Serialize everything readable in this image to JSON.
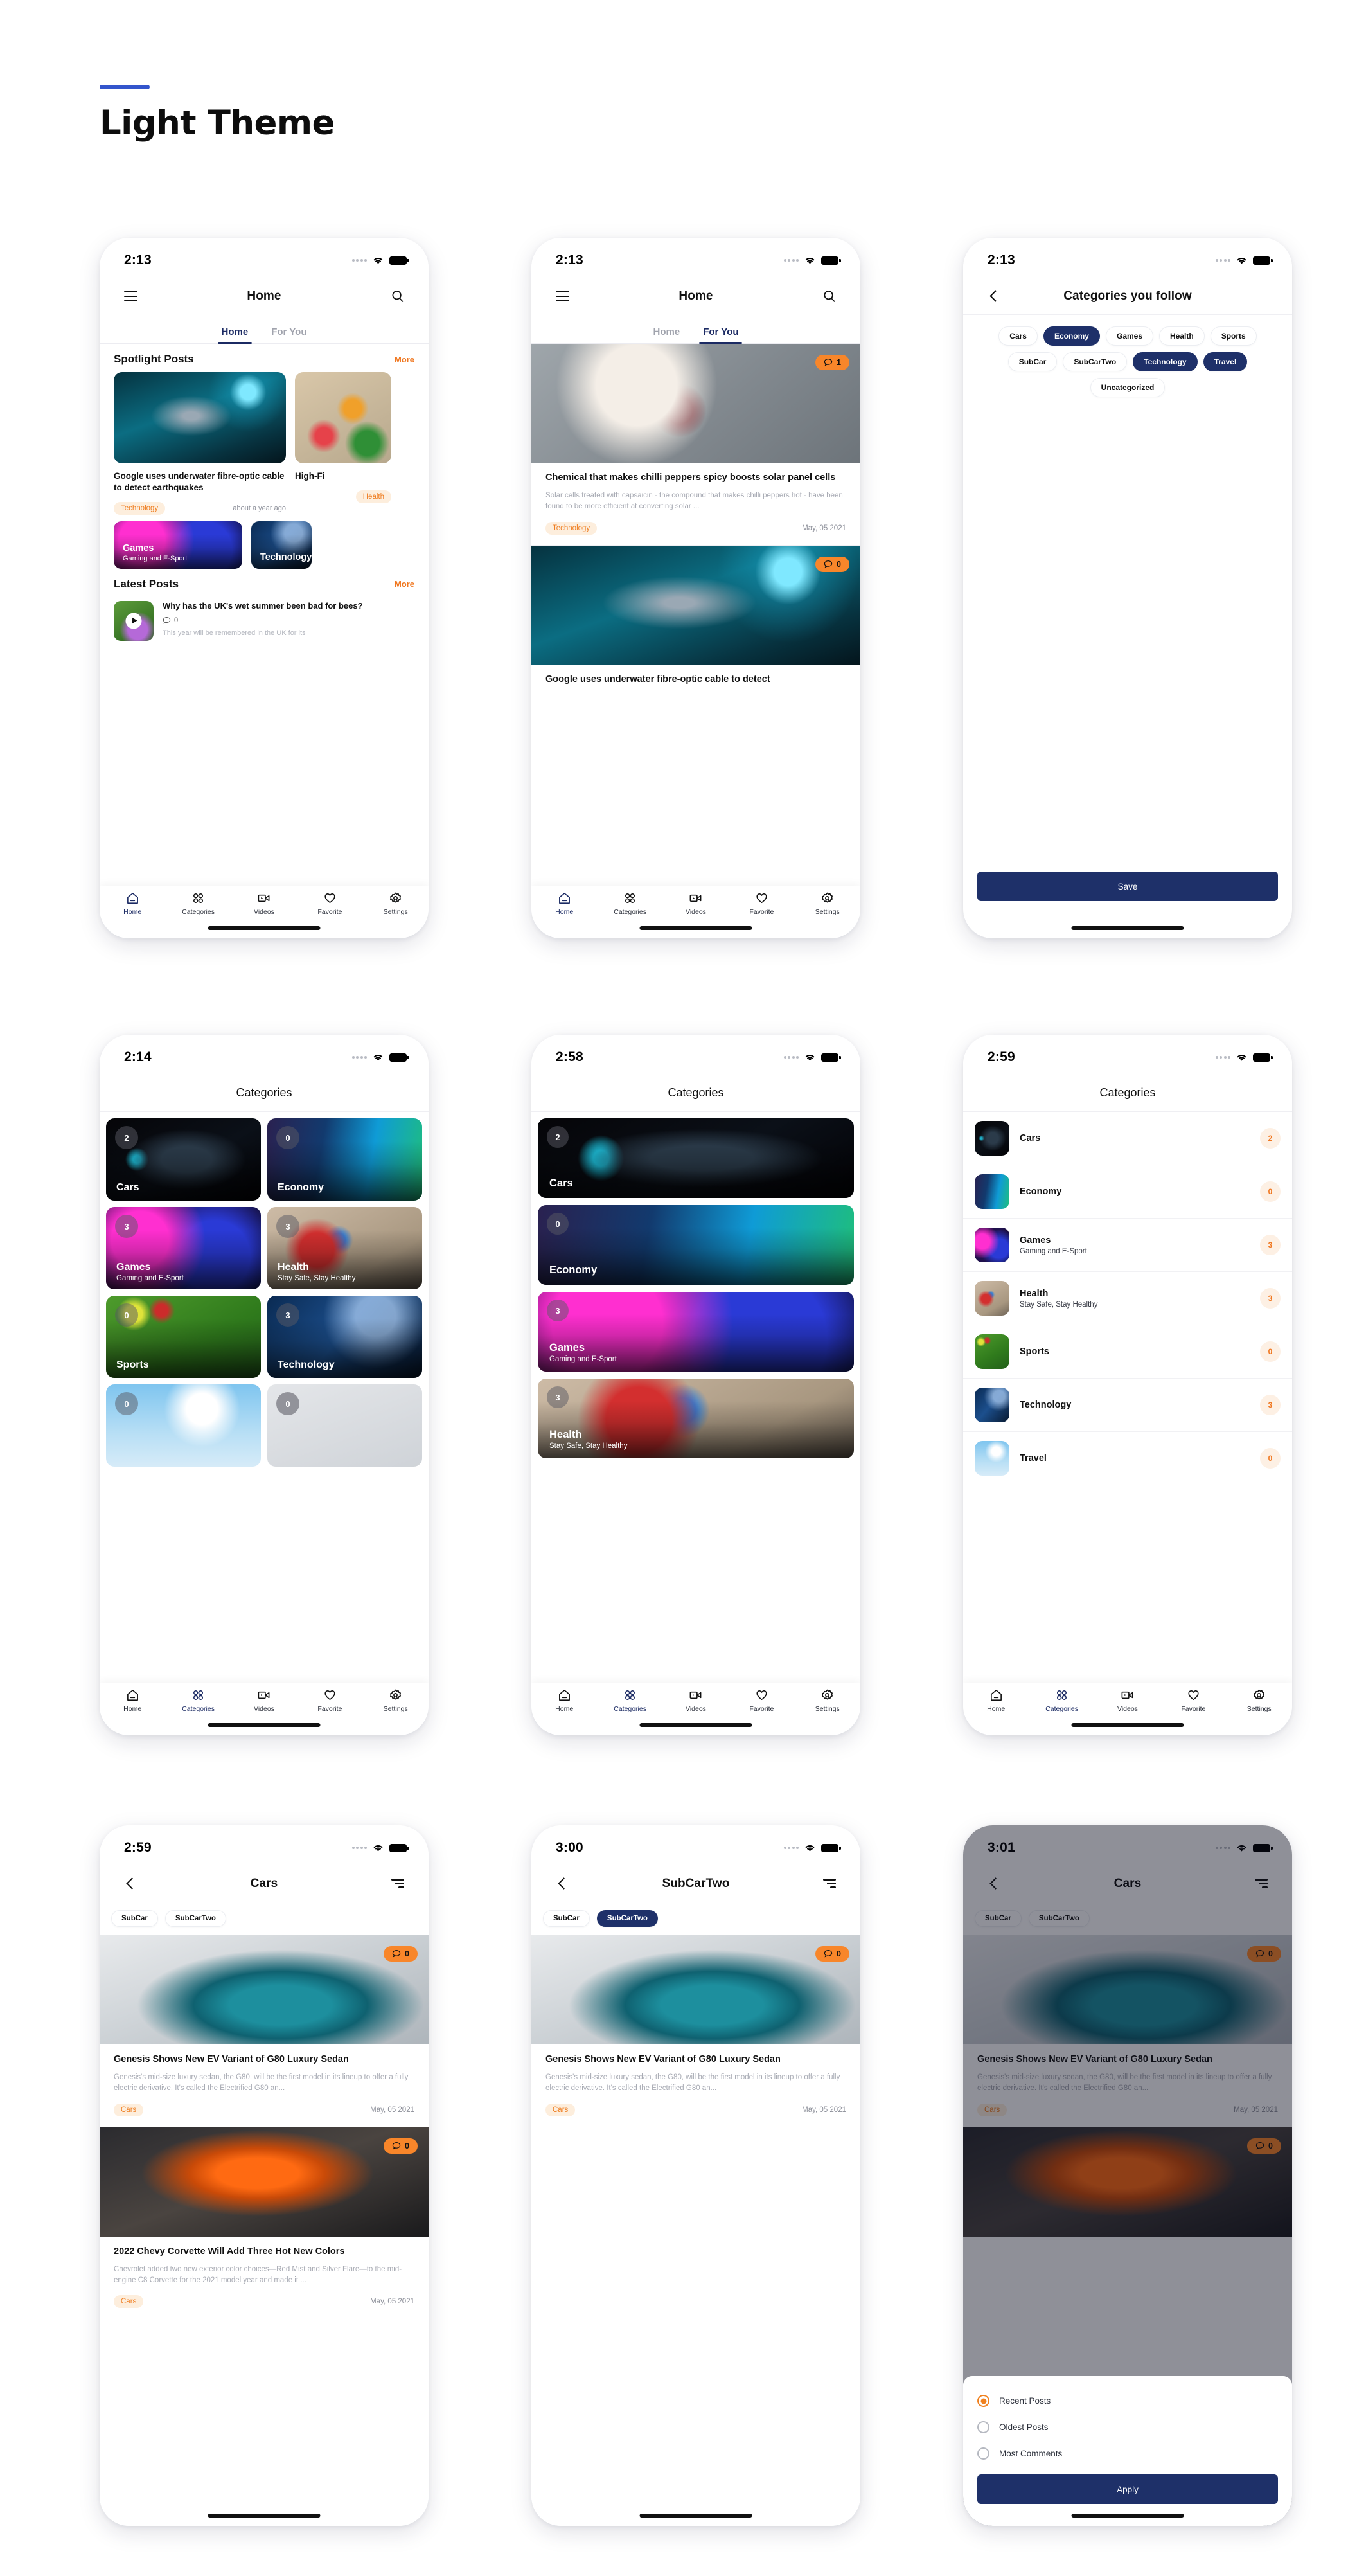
{
  "page": {
    "title": "Light Theme"
  },
  "status": {
    "time_213": "2:13",
    "time_214": "2:14",
    "time_258": "2:58",
    "time_259": "2:59",
    "time_300": "3:00",
    "time_301": "3:01"
  },
  "nav": {
    "items": [
      {
        "label": "Home",
        "icon": "home-icon"
      },
      {
        "label": "Categories",
        "icon": "grid-icon"
      },
      {
        "label": "Videos",
        "icon": "video-icon"
      },
      {
        "label": "Favorite",
        "icon": "heart-icon"
      },
      {
        "label": "Settings",
        "icon": "gear-icon"
      }
    ]
  },
  "screen_home": {
    "appbar_title": "Home",
    "menu_icon": "hamburger-icon",
    "search_icon": "search-icon",
    "tabs": [
      {
        "label": "Home",
        "active": true
      },
      {
        "label": "For You",
        "active": false
      }
    ],
    "spotlight": {
      "heading": "Spotlight Posts",
      "more": "More",
      "posts": [
        {
          "title": "Google uses underwater fibre-optic cable to detect earthquakes",
          "category": "Technology",
          "date": "about a year ago"
        },
        {
          "title": "High-Fi",
          "category": "Health"
        }
      ]
    },
    "category_tiles": [
      {
        "name": "Games",
        "sub": "Gaming and E-Sport"
      },
      {
        "name": "Technology",
        "sub": ""
      }
    ],
    "latest": {
      "heading": "Latest Posts",
      "more": "More",
      "post": {
        "title": "Why has the UK's wet summer been bad for bees?",
        "comments": "0",
        "excerpt": "This year will be remembered in the UK for its"
      }
    }
  },
  "screen_foryou": {
    "appbar_title": "Home",
    "tabs": [
      {
        "label": "Home",
        "active": false
      },
      {
        "label": "For You",
        "active": true
      }
    ],
    "posts": [
      {
        "comments": "1",
        "title": "Chemical that makes chilli peppers spicy boosts solar panel cells",
        "excerpt": "Solar cells treated with capsaicin - the compound that makes chilli peppers hot - have been found to be more efficient at converting solar ...",
        "category": "Technology",
        "date": "May, 05 2021"
      },
      {
        "comments": "0",
        "title": "Google uses underwater fibre-optic cable to detect",
        "excerpt": "",
        "category": "",
        "date": ""
      }
    ]
  },
  "screen_follow": {
    "appbar_title": "Categories you follow",
    "back_icon": "chevron-left-icon",
    "chips": [
      {
        "label": "Cars",
        "selected": false
      },
      {
        "label": "Economy",
        "selected": true
      },
      {
        "label": "Games",
        "selected": false
      },
      {
        "label": "Health",
        "selected": false
      },
      {
        "label": "Sports",
        "selected": false
      },
      {
        "label": "SubCar",
        "selected": false
      },
      {
        "label": "SubCarTwo",
        "selected": false
      },
      {
        "label": "Technology",
        "selected": true
      },
      {
        "label": "Travel",
        "selected": true
      },
      {
        "label": "Uncategorized",
        "selected": false
      }
    ],
    "save_label": "Save"
  },
  "screen_cat_grid": {
    "appbar_title": "Categories",
    "items": [
      {
        "name": "Cars",
        "sub": "",
        "count": "2",
        "img": "img-mercedes"
      },
      {
        "name": "Economy",
        "sub": "",
        "count": "0",
        "img": "img-economy"
      },
      {
        "name": "Games",
        "sub": "Gaming and E-Sport",
        "count": "3",
        "img": "img-games"
      },
      {
        "name": "Health",
        "sub": "Stay Safe, Stay Healthy",
        "count": "3",
        "img": "img-health"
      },
      {
        "name": "Sports",
        "sub": "",
        "count": "0",
        "img": "img-sports"
      },
      {
        "name": "Technology",
        "sub": "",
        "count": "3",
        "img": "img-tech"
      },
      {
        "name": "",
        "sub": "",
        "count": "0",
        "img": "img-travel"
      },
      {
        "name": "",
        "sub": "",
        "count": "0",
        "img": "img-uncat"
      }
    ]
  },
  "screen_cat_wide": {
    "appbar_title": "Categories",
    "items": [
      {
        "name": "Cars",
        "sub": "",
        "count": "2",
        "img": "img-mercedes"
      },
      {
        "name": "Economy",
        "sub": "",
        "count": "0",
        "img": "img-economy"
      },
      {
        "name": "Games",
        "sub": "Gaming and E-Sport",
        "count": "3",
        "img": "img-games"
      },
      {
        "name": "Health",
        "sub": "Stay Safe, Stay Healthy",
        "count": "3",
        "img": "img-health"
      }
    ]
  },
  "screen_cat_list": {
    "appbar_title": "Categories",
    "items": [
      {
        "name": "Cars",
        "sub": "",
        "count": "2",
        "img": "img-mercedes"
      },
      {
        "name": "Economy",
        "sub": "",
        "count": "0",
        "img": "img-economy"
      },
      {
        "name": "Games",
        "sub": "Gaming and E-Sport",
        "count": "3",
        "img": "img-games"
      },
      {
        "name": "Health",
        "sub": "Stay Safe, Stay Healthy",
        "count": "3",
        "img": "img-health"
      },
      {
        "name": "Sports",
        "sub": "",
        "count": "0",
        "img": "img-sports"
      },
      {
        "name": "Technology",
        "sub": "",
        "count": "3",
        "img": "img-tech"
      },
      {
        "name": "Travel",
        "sub": "",
        "count": "0",
        "img": "img-travel"
      }
    ]
  },
  "screen_cars": {
    "appbar_title": "Cars",
    "back_icon": "chevron-left-icon",
    "sort_icon": "sort-icon",
    "subtabs": [
      {
        "label": "SubCar",
        "selected": false
      },
      {
        "label": "SubCarTwo",
        "selected": false
      }
    ],
    "posts": [
      {
        "comments": "0",
        "title": "Genesis Shows New EV Variant of G80 Luxury Sedan",
        "excerpt": "Genesis's mid-size luxury sedan, the G80, will be the first model in its lineup to offer a fully electric derivative. It's called the Electrified G80 an...",
        "category": "Cars",
        "date": "May, 05 2021",
        "img": "img-car"
      },
      {
        "comments": "0",
        "title": "2022 Chevy Corvette Will Add Three Hot New Colors",
        "excerpt": "Chevrolet added two new exterior color choices—Red Mist and Silver Flare—to the mid-engine C8 Corvette for the 2021 model year and made it ...",
        "category": "Cars",
        "date": "May, 05 2021",
        "img": "img-corvette"
      }
    ]
  },
  "screen_subcartwo": {
    "appbar_title": "SubCarTwo",
    "subtabs": [
      {
        "label": "SubCar",
        "selected": false
      },
      {
        "label": "SubCarTwo",
        "selected": true
      }
    ],
    "post": {
      "comments": "0",
      "title": "Genesis Shows New EV Variant of G80 Luxury Sedan",
      "excerpt": "Genesis's mid-size luxury sedan, the G80, will be the first model in its lineup to offer a fully electric derivative. It's called the Electrified G80 an...",
      "category": "Cars",
      "date": "May, 05 2021"
    }
  },
  "screen_sort": {
    "appbar_title": "Cars",
    "subtabs": [
      {
        "label": "SubCar",
        "selected": false
      },
      {
        "label": "SubCarTwo",
        "selected": false
      }
    ],
    "post": {
      "comments": "0",
      "title": "Genesis Shows New EV Variant of G80 Luxury Sedan",
      "excerpt": "Genesis's mid-size luxury sedan, the G80, will be the first model in its lineup to offer a fully electric derivative. It's called the Electrified G80 an...",
      "category": "Cars",
      "date": "May, 05 2021"
    },
    "post2_comments": "0",
    "options": [
      {
        "label": "Recent Posts",
        "selected": true
      },
      {
        "label": "Oldest Posts",
        "selected": false
      },
      {
        "label": "Most Comments",
        "selected": false
      }
    ],
    "apply_label": "Apply"
  },
  "colors": {
    "accent_blue": "#3355cc",
    "navy": "#1e3069",
    "orange": "#f0811f",
    "badge_orange": "#f8862a"
  }
}
